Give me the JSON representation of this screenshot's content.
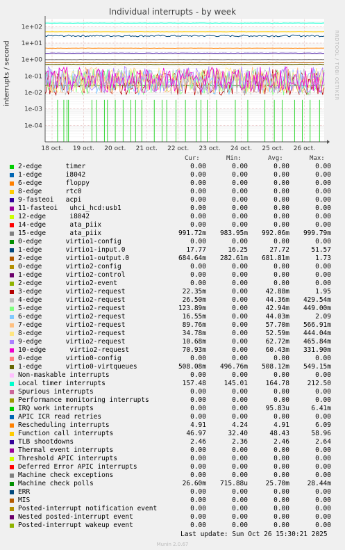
{
  "chart_data": {
    "type": "line",
    "title": "Individual interrupts - by week",
    "ylabel": "interrupts / second",
    "yscale": "log",
    "ylim": [
      1e-05,
      300
    ],
    "yticks": [
      "1e-04",
      "1e-03",
      "1e-02",
      "1e-01",
      "1e+00",
      "1e+01",
      "1e+02"
    ],
    "xticks": [
      "18 oct.",
      "19 oct.",
      "20 oct.",
      "21 oct.",
      "22 oct.",
      "23 oct.",
      "24 oct.",
      "25 oct.",
      "26 oct."
    ],
    "watermark": "RRDTOOL / TOBI OETIKER",
    "legend_headers": [
      "Cur:",
      "Min:",
      "Avg:",
      "Max:"
    ],
    "series": [
      {
        "name": "2-edge      timer",
        "color": "#00cc00",
        "cur": "0.00",
        "min": "0.00",
        "avg": "0.00",
        "max": "0.00"
      },
      {
        "name": "1-edge      i8042",
        "color": "#0066b3",
        "cur": "0.00",
        "min": "0.00",
        "avg": "0.00",
        "max": "0.00"
      },
      {
        "name": "6-edge      floppy",
        "color": "#ff8000",
        "cur": "0.00",
        "min": "0.00",
        "avg": "0.00",
        "max": "0.00"
      },
      {
        "name": "8-edge      rtc0",
        "color": "#ffcc00",
        "cur": "0.00",
        "min": "0.00",
        "avg": "0.00",
        "max": "0.00"
      },
      {
        "name": "9-fasteoi   acpi",
        "color": "#330099",
        "cur": "0.00",
        "min": "0.00",
        "avg": "0.00",
        "max": "0.00"
      },
      {
        "name": "11-fasteoi   uhci_hcd:usb1",
        "color": "#990099",
        "cur": "0.00",
        "min": "0.00",
        "avg": "0.00",
        "max": "0.00"
      },
      {
        "name": "12-edge      i8042",
        "color": "#ccff00",
        "cur": "0.00",
        "min": "0.00",
        "avg": "0.00",
        "max": "0.00"
      },
      {
        "name": "14-edge      ata_piix",
        "color": "#ff0000",
        "cur": "0.00",
        "min": "0.00",
        "avg": "0.00",
        "max": "0.00"
      },
      {
        "name": "15-edge      ata_piix",
        "color": "#808080",
        "cur": "991.72m",
        "min": "983.95m",
        "avg": "992.06m",
        "max": "999.79m"
      },
      {
        "name": "0-edge      virtio1-config",
        "color": "#008f00",
        "cur": "0.00",
        "min": "0.00",
        "avg": "0.00",
        "max": "0.00"
      },
      {
        "name": "1-edge      virtio1-input.0",
        "color": "#00487d",
        "cur": "17.77",
        "min": "16.25",
        "avg": "27.72",
        "max": "51.57"
      },
      {
        "name": "2-edge      virtio1-output.0",
        "color": "#b35a00",
        "cur": "684.64m",
        "min": "282.61m",
        "avg": "681.81m",
        "max": "1.73"
      },
      {
        "name": "0-edge      virtio2-config",
        "color": "#b38f00",
        "cur": "0.00",
        "min": "0.00",
        "avg": "0.00",
        "max": "0.00"
      },
      {
        "name": "1-edge      virtio2-control",
        "color": "#6b006b",
        "cur": "0.00",
        "min": "0.00",
        "avg": "0.00",
        "max": "0.00"
      },
      {
        "name": "2-edge      virtio2-event",
        "color": "#8fb300",
        "cur": "0.00",
        "min": "0.00",
        "avg": "0.00",
        "max": "0.00"
      },
      {
        "name": "3-edge      virtio2-request",
        "color": "#b30000",
        "cur": "22.35m",
        "min": "0.00",
        "avg": "42.88m",
        "max": "1.95"
      },
      {
        "name": "4-edge      virtio2-request",
        "color": "#bebebe",
        "cur": "26.50m",
        "min": "0.00",
        "avg": "44.36m",
        "max": "429.54m"
      },
      {
        "name": "5-edge      virtio2-request",
        "color": "#80ff80",
        "cur": "123.89m",
        "min": "0.00",
        "avg": "42.94m",
        "max": "449.00m"
      },
      {
        "name": "6-edge      virtio2-request",
        "color": "#80c9ff",
        "cur": "16.55m",
        "min": "0.00",
        "avg": "44.03m",
        "max": "2.09"
      },
      {
        "name": "7-edge      virtio2-request",
        "color": "#ffc080",
        "cur": "89.76m",
        "min": "0.00",
        "avg": "57.70m",
        "max": "566.91m"
      },
      {
        "name": "8-edge      virtio2-request",
        "color": "#ffe680",
        "cur": "34.78m",
        "min": "0.00",
        "avg": "52.59m",
        "max": "444.04m"
      },
      {
        "name": "9-edge      virtio2-request",
        "color": "#aa80ff",
        "cur": "10.68m",
        "min": "0.00",
        "avg": "62.72m",
        "max": "465.84m"
      },
      {
        "name": "10-edge      virtio2-request",
        "color": "#ee00cc",
        "cur": "70.93m",
        "min": "0.00",
        "avg": "60.43m",
        "max": "331.90m"
      },
      {
        "name": "0-edge      virtio0-config",
        "color": "#ff8080",
        "cur": "0.00",
        "min": "0.00",
        "avg": "0.00",
        "max": "0.00"
      },
      {
        "name": "1-edge      virtio0-virtqueues",
        "color": "#666600",
        "cur": "508.08m",
        "min": "496.76m",
        "avg": "508.12m",
        "max": "549.15m"
      },
      {
        "name": "Non-maskable interrupts",
        "color": "#ffbfff",
        "cur": "0.00",
        "min": "0.00",
        "avg": "0.00",
        "max": "0.00"
      },
      {
        "name": "Local timer interrupts",
        "color": "#00ffcc",
        "cur": "157.48",
        "min": "145.01",
        "avg": "164.78",
        "max": "212.50"
      },
      {
        "name": "Spurious interrupts",
        "color": "#cc6699",
        "cur": "0.00",
        "min": "0.00",
        "avg": "0.00",
        "max": "0.00"
      },
      {
        "name": "Performance monitoring interrupts",
        "color": "#999900",
        "cur": "0.00",
        "min": "0.00",
        "avg": "0.00",
        "max": "0.00"
      },
      {
        "name": "IRQ work interrupts",
        "color": "#00cc00",
        "cur": "0.00",
        "min": "0.00",
        "avg": "95.83u",
        "max": "6.41m"
      },
      {
        "name": "APIC ICR read retries",
        "color": "#0066b3",
        "cur": "0.00",
        "min": "0.00",
        "avg": "0.00",
        "max": "0.00"
      },
      {
        "name": "Rescheduling interrupts",
        "color": "#ff8000",
        "cur": "4.91",
        "min": "4.24",
        "avg": "4.91",
        "max": "6.09"
      },
      {
        "name": "Function call interrupts",
        "color": "#ffcc00",
        "cur": "46.97",
        "min": "32.40",
        "avg": "48.43",
        "max": "58.96"
      },
      {
        "name": "TLB shootdowns",
        "color": "#330099",
        "cur": "2.46",
        "min": "2.36",
        "avg": "2.46",
        "max": "2.64"
      },
      {
        "name": "Thermal event interrupts",
        "color": "#990099",
        "cur": "0.00",
        "min": "0.00",
        "avg": "0.00",
        "max": "0.00"
      },
      {
        "name": "Threshold APIC interrupts",
        "color": "#ccff00",
        "cur": "0.00",
        "min": "0.00",
        "avg": "0.00",
        "max": "0.00"
      },
      {
        "name": "Deferred Error APIC interrupts",
        "color": "#ff0000",
        "cur": "0.00",
        "min": "0.00",
        "avg": "0.00",
        "max": "0.00"
      },
      {
        "name": "Machine check exceptions",
        "color": "#808080",
        "cur": "0.00",
        "min": "0.00",
        "avg": "0.00",
        "max": "0.00"
      },
      {
        "name": "Machine check polls",
        "color": "#008f00",
        "cur": "26.60m",
        "min": "715.88u",
        "avg": "25.70m",
        "max": "28.44m"
      },
      {
        "name": "ERR",
        "color": "#00487d",
        "cur": "0.00",
        "min": "0.00",
        "avg": "0.00",
        "max": "0.00"
      },
      {
        "name": "MIS",
        "color": "#b35a00",
        "cur": "0.00",
        "min": "0.00",
        "avg": "0.00",
        "max": "0.00"
      },
      {
        "name": "Posted-interrupt notification event",
        "color": "#b38f00",
        "cur": "0.00",
        "min": "0.00",
        "avg": "0.00",
        "max": "0.00"
      },
      {
        "name": "Nested posted-interrupt event",
        "color": "#6b006b",
        "cur": "0.00",
        "min": "0.00",
        "avg": "0.00",
        "max": "0.00"
      },
      {
        "name": "Posted-interrupt wakeup event",
        "color": "#8fb300",
        "cur": "0.00",
        "min": "0.00",
        "avg": "0.00",
        "max": "0.00"
      }
    ]
  },
  "footer": {
    "last_update": "Last update: Sun Oct 26 15:30:21 2025",
    "munin": "Munin 2.0.67"
  }
}
